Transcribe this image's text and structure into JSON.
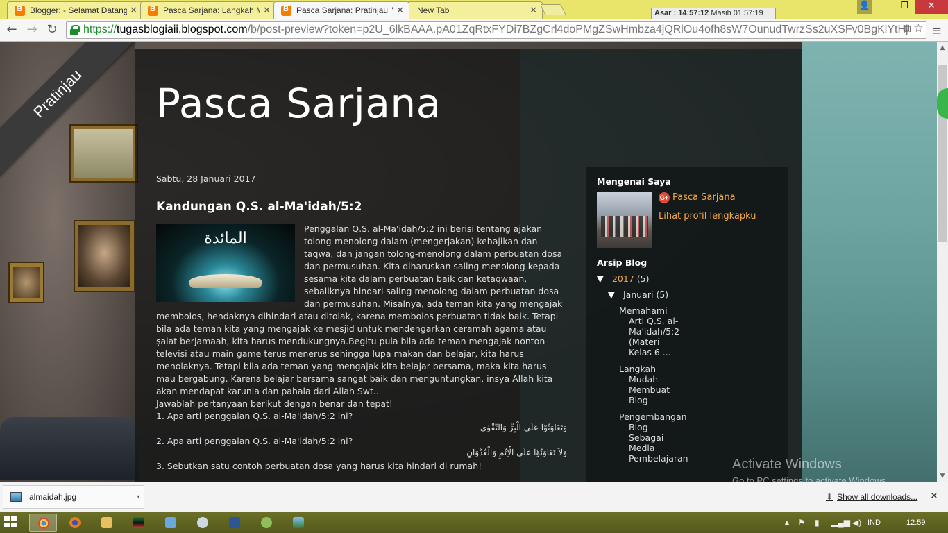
{
  "browser": {
    "tabs": [
      {
        "title": "Blogger: - Selamat Datang",
        "active": false,
        "icon": "blogger-icon"
      },
      {
        "title": "Pasca Sarjana: Langkah M",
        "active": false,
        "icon": "blogger-icon"
      },
      {
        "title": "Pasca Sarjana: Pratinjau \"K",
        "active": true,
        "icon": "blogger-icon"
      },
      {
        "title": "New Tab",
        "active": false,
        "icon": ""
      }
    ],
    "prayer_clock": {
      "label": "Asar :",
      "time": "14:57:12",
      "remaining": "Masih 01:57:19"
    },
    "url": {
      "scheme": "https://",
      "host": "tugasblogiaii.blogspot.com",
      "path": "/b/post-preview?token=p2U_6lkBAAA.pA01ZqRtxFYDi7BZgCrl4doPMgZSwHmbza4jQRlOu4ofh8sW7OunudTwrzSs2uXSFv0BgKlYtHj"
    }
  },
  "ribbon": "Pratinjau",
  "blog": {
    "title": "Pasca Sarjana",
    "post": {
      "date": "Sabtu, 28 Januari 2017",
      "title": "Kandungan Q.S. al-Ma'idah/5:2",
      "image_caption": "المائدة",
      "body": "Penggalan  Q.S. al-Ma'idah/5:2 ini berisi tentang ajakan tolong-menolong dalam (mengerjakan) kebajikan dan taqwa, dan jangan tolong-menolong dalam perbuatan  dosa dan permusuhan. Kita diharuskan saling menolong kepada sesama  kita dalam perbuatan baik dan ketaqwaan, sebaliknya hindari saling menolong dalam perbuatan dosa dan permusuhan. Misalnya, ada teman kita yang mengajak membolos, hendaknya dihindari atau ditolak, karena membolos perbuatan tidak baik. Tetapi bila ada teman kita yang mengajak ke mesjid untuk mendengarkan ceramah agama atau ṣalat berjamaah, kita harus mendukungnya.Begitu pula bila ada teman mengajak nonton televisi atau main game terus menerus sehingga lupa makan dan belajar, kita harus menolaknya. Tetapi bila ada teman yang mengajak kita belajar bersama, maka kita harus mau bergabung.  Karena belajar bersama sangat baik dan menguntungkan,  insya Allah kita akan mendapat karunia dan pahala dari Allah Swt..",
      "questions_intro": "Jawablah pertanyaan berikut dengan benar dan tepat!",
      "questions": [
        {
          "text": "1.  Apa arti penggalan Q.S. al-Ma'idah/5:2 ini?",
          "arabic": "وَتَعَاوَنُوْا عَلَى الْبِرِّ وَالتَّقْوٰى"
        },
        {
          "text": "2.  Apa arti penggalan Q.S. al-Ma'idah/5:2 ini?",
          "arabic": "وَلاَ تَعَاوَنُوْا عَلَى الْاِثْمِ وَالْعُدْوَانِ"
        },
        {
          "text": "3.  Sebutkan satu contoh perbuatan dosa yang harus kita hindari di rumah!",
          "arabic": ""
        }
      ]
    },
    "sidebar": {
      "about_heading": "Mengenai Saya",
      "profile_name": "Pasca Sarjana",
      "profile_link": "Lihat profil lengkapku",
      "archive_heading": "Arsip Blog",
      "year": {
        "toggle": "▼",
        "label": "2017",
        "count": "(5)"
      },
      "month": {
        "toggle": "▼",
        "label": "Januari",
        "count": "(5)"
      },
      "posts": [
        "Memahami Arti Q.S. al-Ma'idah/5:2 (Materi Kelas 6 ...",
        "Langkah Mudah Membuat Blog",
        "Pengembangan Blog Sebagai Media Pembelajaran"
      ]
    }
  },
  "watermark": {
    "line1": "Activate Windows",
    "line2": "Go to PC settings to activate Windows."
  },
  "downloads": {
    "file": "almaidah.jpg",
    "show_all": "Show all downloads..."
  },
  "taskbar": {
    "lang": "IND",
    "time": "12:59"
  }
}
